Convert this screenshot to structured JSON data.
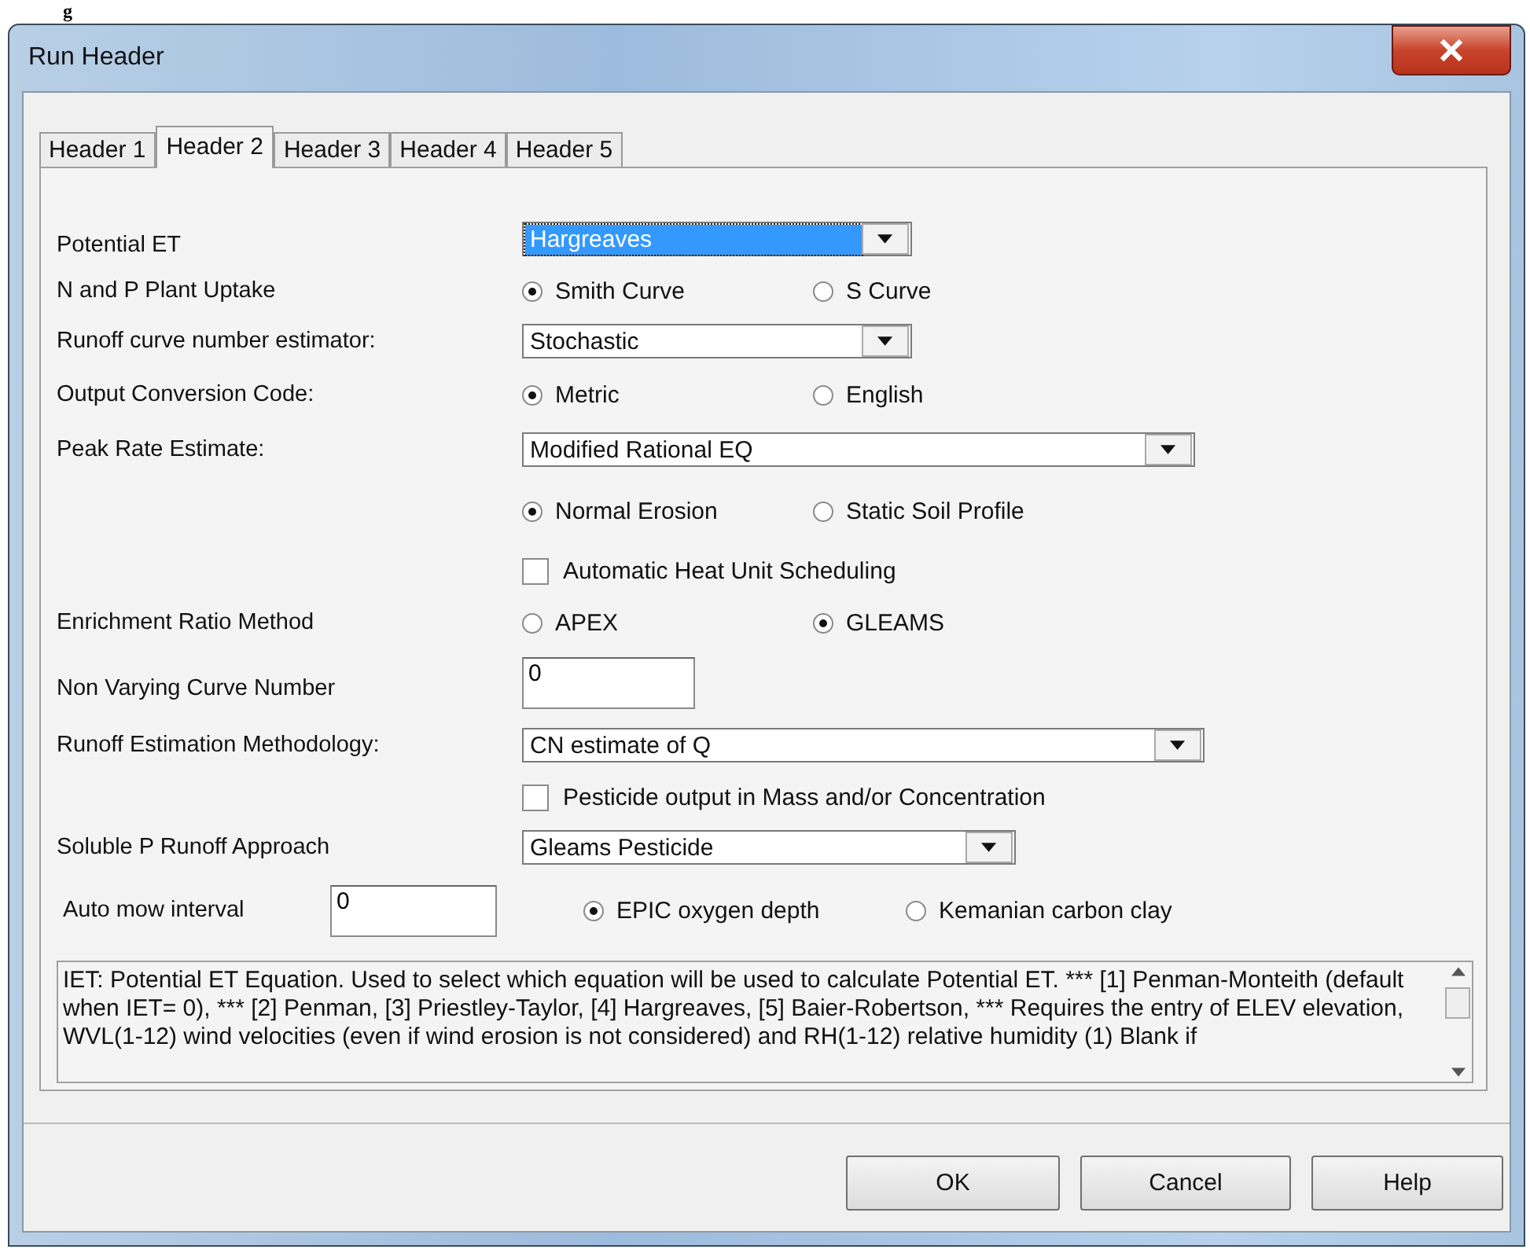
{
  "background_text": "g",
  "window": {
    "title": "Run Header"
  },
  "tabs": [
    {
      "label": "Header 1",
      "selected": false
    },
    {
      "label": "Header 2",
      "selected": true
    },
    {
      "label": "Header 3",
      "selected": false
    },
    {
      "label": "Header 4",
      "selected": false
    },
    {
      "label": "Header 5",
      "selected": false
    }
  ],
  "rows": [
    {
      "kind": "combo",
      "label": "Potential ET",
      "value": "Hargreaves",
      "focused": true
    },
    {
      "kind": "radios",
      "label": "N and P Plant Uptake",
      "options": [
        {
          "label": "Smith Curve",
          "selected": true
        },
        {
          "label": "S Curve",
          "selected": false
        }
      ]
    },
    {
      "kind": "combo",
      "label": "Runoff curve number estimator:",
      "value": "Stochastic",
      "focused": false
    },
    {
      "kind": "radios",
      "label": "Output Conversion Code:",
      "options": [
        {
          "label": "Metric",
          "selected": true
        },
        {
          "label": "English",
          "selected": false
        }
      ]
    },
    {
      "kind": "combo",
      "label": "Peak Rate Estimate:",
      "value": "Modified Rational EQ",
      "focused": false
    },
    {
      "kind": "radios",
      "options": [
        {
          "label": "Normal Erosion",
          "selected": true
        },
        {
          "label": "Static Soil Profile",
          "selected": false
        }
      ]
    },
    {
      "kind": "checkbox",
      "label": "Automatic Heat Unit Scheduling",
      "checked": false
    },
    {
      "kind": "radios",
      "label": "Enrichment Ratio Method",
      "options": [
        {
          "label": "APEX",
          "selected": false
        },
        {
          "label": "GLEAMS",
          "selected": true
        }
      ]
    },
    {
      "kind": "input",
      "label": "Non Varying Curve Number",
      "value": "0"
    },
    {
      "kind": "combo",
      "label": "Runoff Estimation Methodology:",
      "value": "CN estimate of Q",
      "focused": false
    },
    {
      "kind": "checkbox",
      "label": "Pesticide output in Mass and/or Concentration",
      "checked": false
    },
    {
      "kind": "combo",
      "label": "Soluble P Runoff Approach",
      "value": "Gleams Pesticide",
      "focused": false
    }
  ],
  "auto_mow": {
    "label": "Auto mow interval",
    "value": "0",
    "options": [
      {
        "label": "EPIC oxygen depth",
        "selected": true
      },
      {
        "label": "Kemanian carbon clay",
        "selected": false
      }
    ]
  },
  "description": "IET: Potential ET Equation. Used to select which equation will be used to calculate Potential ET.   *** [1] Penman-Monteith (default when IET= 0), *** [2] Penman, [3] Priestley-Taylor, [4] Hargreaves, [5] Baier-Robertson, ***  Requires the entry of ELEV elevation, WVL(1-12) wind velocities (even if wind erosion is not considered) and RH(1-12) relative humidity (1)  Blank if",
  "buttons": [
    "OK",
    "Cancel",
    "Help"
  ]
}
